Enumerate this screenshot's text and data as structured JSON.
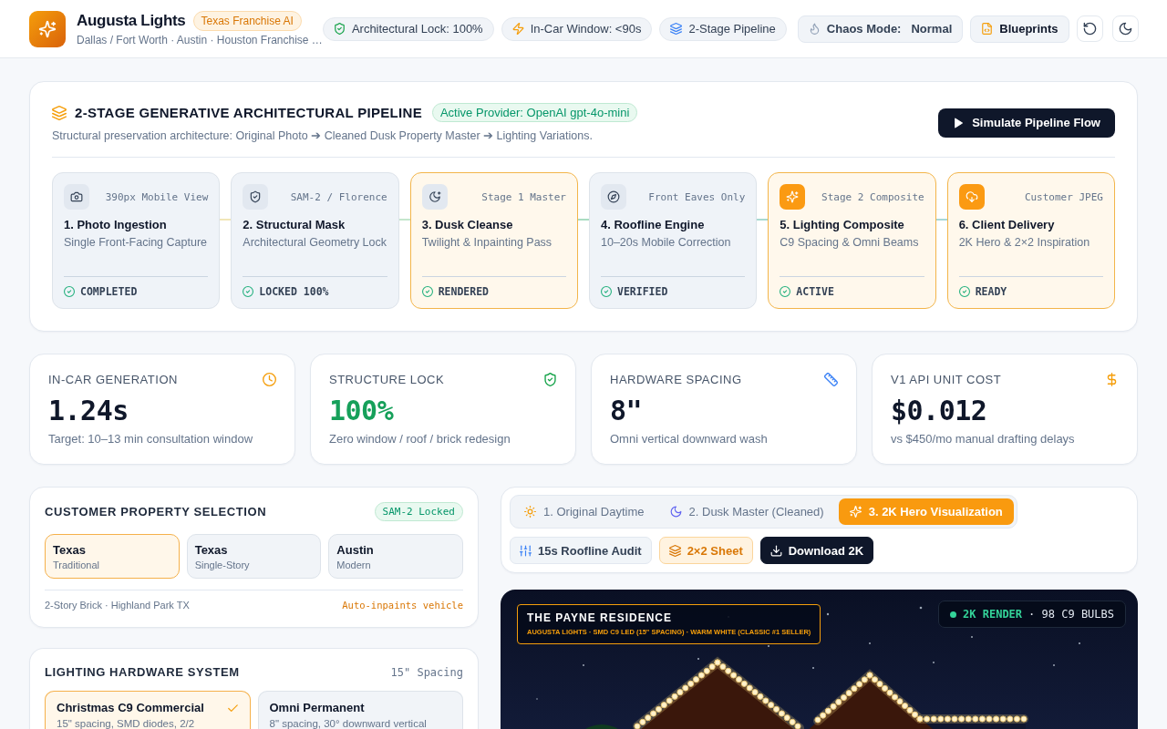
{
  "header": {
    "app_name": "Augusta Lights",
    "badge": "Texas Franchise AI",
    "subtitle": "Dallas / Fort Worth · Austin · Houston Franchise …",
    "pills": [
      {
        "label": "Architectural Lock: 100%"
      },
      {
        "label": "In-Car Window: <90s"
      },
      {
        "label": "2-Stage Pipeline"
      }
    ],
    "chaos_mode": {
      "label": "Chaos Mode:",
      "value": "Normal"
    },
    "blueprints_button": "Blueprints"
  },
  "pipeline": {
    "title": "2-STAGE GENERATIVE ARCHITECTURAL PIPELINE",
    "provider_badge": "Active Provider: OpenAI gpt-4o-mini",
    "description": "Structural preservation architecture: Original Photo ➔ Cleaned Dusk Property Master ➔ Lighting Variations.",
    "simulate_button": "Simulate Pipeline Flow",
    "stages": [
      {
        "tag": "390px Mobile View",
        "title": "1. Photo Ingestion",
        "subtitle": "Single Front-Facing Capture",
        "status": "COMPLETED",
        "highlighted": false,
        "icon_filled": false
      },
      {
        "tag": "SAM-2 / Florence",
        "title": "2. Structural Mask",
        "subtitle": "Architectural Geometry Lock",
        "status": "LOCKED 100%",
        "highlighted": false,
        "icon_filled": false
      },
      {
        "tag": "Stage 1 Master",
        "title": "3. Dusk Cleanse",
        "subtitle": "Twilight & Inpainting Pass",
        "status": "RENDERED",
        "highlighted": true,
        "icon_filled": false
      },
      {
        "tag": "Front Eaves Only",
        "title": "4. Roofline Engine",
        "subtitle": "10–20s Mobile Correction",
        "status": "VERIFIED",
        "highlighted": false,
        "icon_filled": false
      },
      {
        "tag": "Stage 2 Composite",
        "title": "5. Lighting Composite",
        "subtitle": "C9 Spacing & Omni Beams",
        "status": "ACTIVE",
        "highlighted": true,
        "icon_filled": true
      },
      {
        "tag": "Customer JPEG",
        "title": "6. Client Delivery",
        "subtitle": "2K Hero & 2×2 Inspiration",
        "status": "READY",
        "highlighted": true,
        "icon_filled": true
      }
    ]
  },
  "metrics": [
    {
      "label": "IN-CAR GENERATION",
      "value": "1.24s",
      "note": "Target: 10–13 min consultation window",
      "accent": false
    },
    {
      "label": "STRUCTURE LOCK",
      "value": "100%",
      "note": "Zero window / roof / brick redesign",
      "accent": true
    },
    {
      "label": "HARDWARE SPACING",
      "value": "8\"",
      "note": "Omni vertical downward wash",
      "accent": false
    },
    {
      "label": "V1 API UNIT COST",
      "value": "$0.012",
      "note": "vs $450/mo manual drafting delays",
      "accent": false
    }
  ],
  "property_selection": {
    "title": "CUSTOMER PROPERTY SELECTION",
    "badge": "SAM-2 Locked",
    "options": [
      {
        "name": "Texas",
        "style": "Traditional",
        "selected": true
      },
      {
        "name": "Texas",
        "style": "Single-Story",
        "selected": false
      },
      {
        "name": "Austin",
        "style": "Modern",
        "selected": false
      }
    ],
    "address": "2-Story Brick · Highland Park TX",
    "note": "Auto-inpaints vehicle"
  },
  "lighting_hardware": {
    "title": "LIGHTING HARDWARE SYSTEM",
    "spacing": "15\" Spacing",
    "options": [
      {
        "name": "Christmas C9 Commercial",
        "detail": "15\" spacing, SMD diodes, 2/2",
        "selected": true
      },
      {
        "name": "Omni Permanent",
        "detail": "8\" spacing, 30° downward vertical",
        "selected": false
      }
    ]
  },
  "view_tabs": [
    {
      "label": "1. Original Daytime",
      "selected": false
    },
    {
      "label": "2. Dusk Master (Cleaned)",
      "selected": false
    },
    {
      "label": "3. 2K Hero Visualization",
      "selected": true
    }
  ],
  "actions": [
    {
      "label": "15s Roofline Audit",
      "kind": "outline"
    },
    {
      "label": "2×2 Sheet",
      "kind": "highlight"
    },
    {
      "label": "Download 2K",
      "kind": "primary"
    }
  ],
  "render": {
    "title": "THE PAYNE RESIDENCE",
    "caption": "AUGUSTA LIGHTS · SMD C9 LED (15\" SPACING) · WARM WHITE (CLASSIC #1 SELLER)",
    "badge_label": "2K RENDER",
    "badge_detail": "· 98 C9 BULBS"
  }
}
